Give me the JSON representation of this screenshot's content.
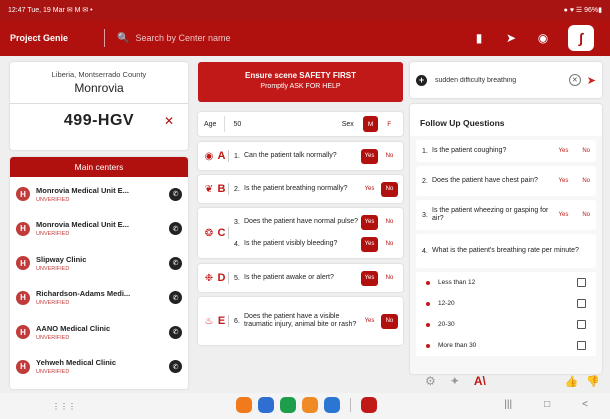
{
  "status_bar": {
    "left": "12:47 Tue, 19 Mar ✉ M ✉ •",
    "right": "● ♥ ☰ 96%▮"
  },
  "app_bar": {
    "title": "Project Genie",
    "search_placeholder": "Search by Center name",
    "icons": [
      "search-icon",
      "document-icon",
      "send-icon",
      "record-icon",
      "pulse-logo-icon"
    ]
  },
  "location": {
    "county": "Liberia, Montserrado County",
    "city": "Monrovia",
    "plate": "499-HGV"
  },
  "centers": {
    "header": "Main centers",
    "items": [
      {
        "name": "Monrovia Medical Unit E...",
        "status": "UNVERIFIED"
      },
      {
        "name": "Monrovia Medical Unit E...",
        "status": "UNVERIFIED"
      },
      {
        "name": "Slipway Clinic",
        "status": "UNVERIFIED"
      },
      {
        "name": "Richardson-Adams Medi...",
        "status": "UNVERIFIED"
      },
      {
        "name": "AANO Medical Clinic",
        "status": "UNVERIFIED"
      },
      {
        "name": "Yehweh Medical Clinic",
        "status": "UNVERIFIED"
      }
    ]
  },
  "safety": {
    "line1": "Ensure scene SAFETY FIRST",
    "line2": "Promptly ASK FOR HELP"
  },
  "patient": {
    "age_label": "Age",
    "age_value": "50",
    "sex_label": "Sex",
    "sex_options": [
      "M",
      "F"
    ],
    "sex_selected": "M"
  },
  "yes_label": "Yes",
  "no_label": "No",
  "assessment": [
    {
      "letter": "A",
      "icon": "airway-icon",
      "questions": [
        {
          "num": "1.",
          "text": "Can the patient talk normally?",
          "answer": "yes"
        }
      ]
    },
    {
      "letter": "B",
      "icon": "lungs-icon",
      "questions": [
        {
          "num": "2.",
          "text": "Is the patient breathing normally?",
          "answer": "no"
        }
      ]
    },
    {
      "letter": "C",
      "icon": "bleeding-icon",
      "questions": [
        {
          "num": "3.",
          "text": "Does the patient have normal pulse?",
          "answer": "yes"
        },
        {
          "num": "4.",
          "text": "Is the patient visibly bleeding?",
          "answer": "yes"
        }
      ]
    },
    {
      "letter": "D",
      "icon": "brain-icon",
      "questions": [
        {
          "num": "5.",
          "text": "Is the patient awake or alert?",
          "answer": "yes"
        }
      ]
    },
    {
      "letter": "E",
      "icon": "body-icon",
      "questions": [
        {
          "num": "6.",
          "text": "Does the patient have a visible traumatic injury, animal bite or rash?",
          "answer": "no"
        }
      ]
    }
  ],
  "complaint": {
    "value": "sudden difficulty breathing"
  },
  "followup": {
    "title": "Follow Up Questions",
    "questions": [
      {
        "num": "1.",
        "text": "Is the patient coughing?"
      },
      {
        "num": "2.",
        "text": "Does the patient have chest pain?"
      },
      {
        "num": "3.",
        "text": "Is the patient wheezing or gasping for air?"
      },
      {
        "num": "4.",
        "text": "What is the patient's breathing rate per minute?"
      }
    ],
    "options": [
      "Less than 12",
      "12-20",
      "20-30",
      "More than 30"
    ]
  },
  "colors": {
    "primary": "#b0110f",
    "accent": "#c01917"
  }
}
